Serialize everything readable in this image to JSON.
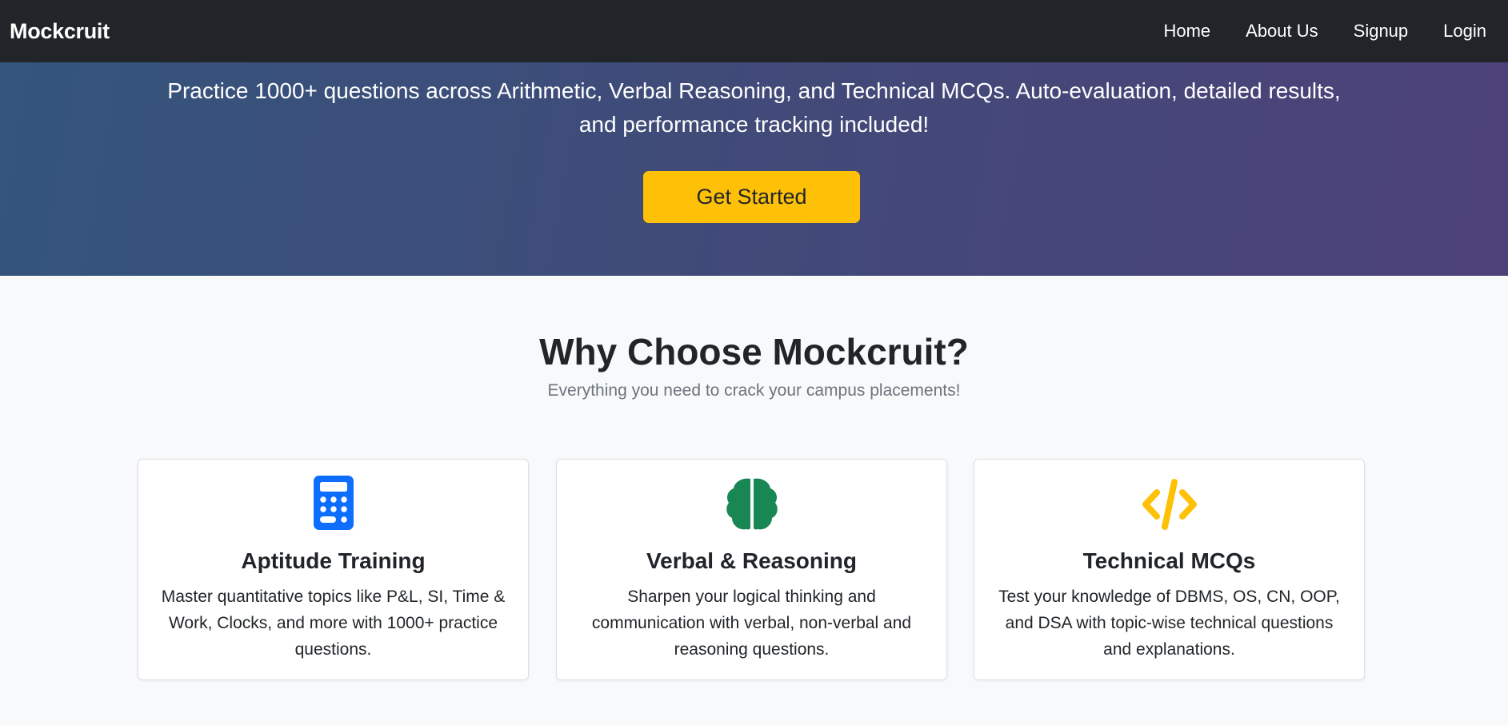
{
  "nav": {
    "brand": "Mockcruit",
    "links": [
      "Home",
      "About Us",
      "Signup",
      "Login"
    ]
  },
  "hero": {
    "text": "Practice 1000+ questions across Arithmetic, Verbal Reasoning, and Technical MCQs. Auto-evaluation, detailed results, and performance tracking included!",
    "cta_label": "Get Started"
  },
  "why": {
    "title": "Why Choose Mockcruit?",
    "subtitle": "Everything you need to crack your campus placements!"
  },
  "features": [
    {
      "icon": "calculator-icon",
      "icon_color": "#0d6efd",
      "title": "Aptitude Training",
      "text": "Master quantitative topics like P&L, SI, Time & Work, Clocks, and more with 1000+ practice questions."
    },
    {
      "icon": "brain-icon",
      "icon_color": "#198754",
      "title": "Verbal & Reasoning",
      "text": "Sharpen your logical thinking and communication with verbal, non-verbal and reasoning questions."
    },
    {
      "icon": "code-icon",
      "icon_color": "#ffc107",
      "title": "Technical MCQs",
      "text": "Test your knowledge of DBMS, OS, CN, OOP, and DSA with topic-wise technical questions and explanations."
    }
  ],
  "colors": {
    "navbar": "#212529",
    "accent": "#ffc107",
    "page_bg": "#f8f9fa"
  }
}
